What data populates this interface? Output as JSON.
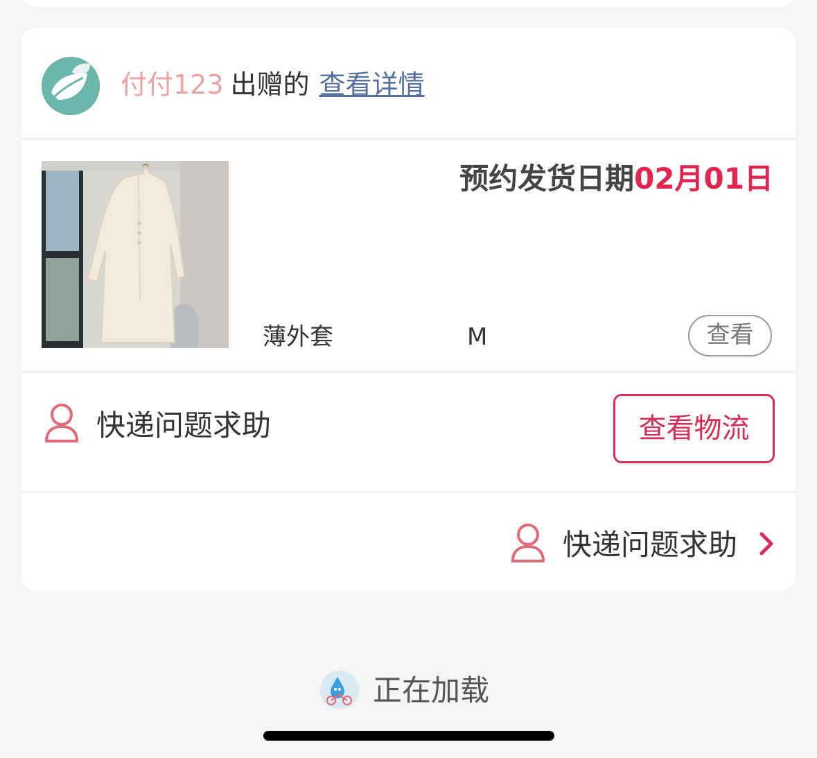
{
  "donation_card": {
    "donor_name": "付付123",
    "donated_by_text": "出赠的",
    "detail_link": "查看详情",
    "ship_date_label": "预约发货日期",
    "ship_date_value": "02月01日",
    "item": {
      "name": "薄外套",
      "size": "M",
      "view_button": "查看"
    },
    "help_row": {
      "help_label": "快递问题求助",
      "logistics_button": "查看物流"
    },
    "footer_help": {
      "label": "快递问题求助"
    }
  },
  "loading": {
    "text": "正在加载"
  },
  "colors": {
    "accent_red": "#d52d58",
    "date_red": "#e0264f",
    "donor_pink": "#eba2a3",
    "link_blue": "#56709d",
    "avatar_teal": "#6bb5aa"
  },
  "icons": {
    "donor_avatar": "leaf-logo-icon",
    "help": "person-icon",
    "more": "chevron-right-icon",
    "loading": "water-drop-bicycle-icon"
  }
}
